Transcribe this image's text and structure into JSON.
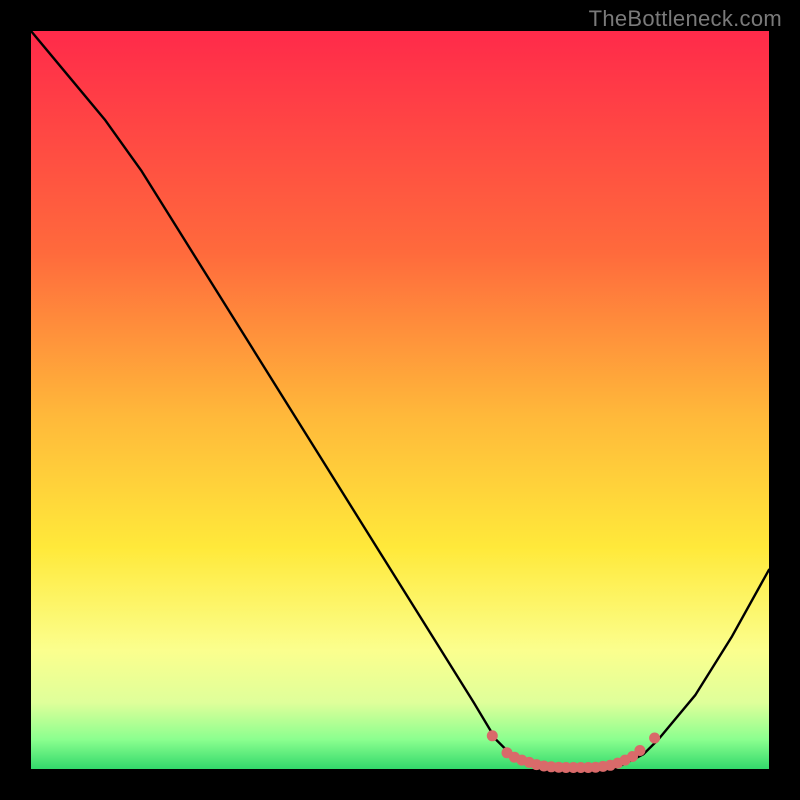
{
  "watermark": "TheBottleneck.com",
  "colors": {
    "bg_black": "#000000",
    "grad_top": "#ff2a4a",
    "grad_mid1": "#ff6a3c",
    "grad_mid2": "#ffb83a",
    "grad_mid3": "#ffe93a",
    "grad_mid4": "#fbff8e",
    "grad_bottom1": "#dfff9a",
    "grad_bottom2": "#8bff8f",
    "grad_bottom3": "#32d96b",
    "line_black": "#000000",
    "marker": "#d96a6a"
  },
  "chart_data": {
    "type": "line",
    "title": "",
    "xlabel": "",
    "ylabel": "",
    "xlim": [
      0,
      100
    ],
    "ylim": [
      0,
      100
    ],
    "x": [
      0,
      5,
      10,
      15,
      20,
      25,
      30,
      35,
      40,
      45,
      50,
      55,
      60,
      63,
      65,
      67,
      69,
      71,
      73,
      75,
      77,
      79,
      81,
      83,
      85,
      90,
      95,
      100
    ],
    "y": [
      100,
      94,
      88,
      81,
      73,
      65,
      57,
      49,
      41,
      33,
      25,
      17,
      9,
      4,
      2,
      1,
      0,
      0,
      0,
      0,
      0,
      0,
      1,
      2,
      4,
      10,
      18,
      27
    ],
    "markers_x": [
      62.5,
      64.5,
      65.5,
      66.5,
      67.5,
      68.5,
      69.5,
      70.5,
      71.5,
      72.5,
      73.5,
      74.5,
      75.5,
      76.5,
      77.5,
      78.5,
      79.5,
      80.5,
      81.5,
      82.5,
      84.5
    ],
    "markers_y": [
      4.5,
      2.2,
      1.6,
      1.2,
      0.9,
      0.6,
      0.4,
      0.3,
      0.25,
      0.2,
      0.2,
      0.2,
      0.2,
      0.25,
      0.35,
      0.5,
      0.8,
      1.2,
      1.7,
      2.5,
      4.2
    ]
  }
}
